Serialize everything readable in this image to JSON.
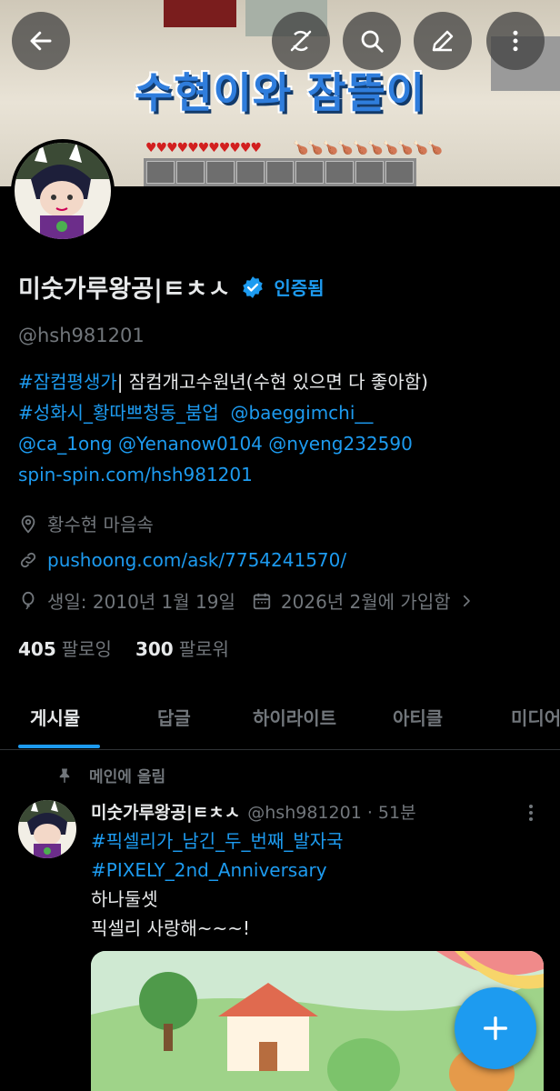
{
  "banner": {
    "title": "수현이와 잠뜰이",
    "hearts": "♥♥♥♥♥♥♥♥♥♥♥",
    "food": "🍗🍗🍗🍗🍗🍗🍗🍗🍗🍗"
  },
  "topbar": {
    "back": "back-arrow-icon",
    "actions": [
      "no-sync-icon",
      "search-icon",
      "edit-pen-icon",
      "more-vertical-icon"
    ]
  },
  "profile": {
    "name": "미숫가루왕공|ㅌㅊㅅ",
    "verified_label": "인증됨",
    "handle": "@hsh981201",
    "bio": {
      "line1_tag": "#잠컴평생가",
      "line1_text": "| 잠컴개고수원년(수현 있으면 다 좋아함)",
      "line2_tag": "#성화시_황따쁘청동_붐업",
      "line2_mention": "@baeggimchi__",
      "line3": "@ca_1ong @Yenanow0104 @nyeng232590",
      "line4": "spin-spin.com/hsh981201"
    },
    "location": "황수현 마음속",
    "website": "pushoong.com/ask/7754241570/",
    "birthday": "생일: 2010년 1월 19일",
    "joined": "2026년 2월에 가입함",
    "following_count": "405",
    "following_label": "팔로잉",
    "followers_count": "300",
    "followers_label": "팔로워"
  },
  "tabs": [
    "게시물",
    "답글",
    "하이라이트",
    "아티클",
    "미디어"
  ],
  "post": {
    "pinned_label": "메인에 올림",
    "author_name": "미숫가루왕공|ㅌㅊㅅ",
    "author_meta": "@hsh981201 · 51분",
    "tag1": "#픽셀리가_남긴_두_번째_발자국",
    "tag2": "#PIXELY_2nd_Anniversary",
    "text1": "하나둘셋",
    "text2": "픽셀리 사랑해~~~!"
  },
  "colors": {
    "accent": "#1d9bf0",
    "muted": "#71767b",
    "text": "#e7e9ea",
    "background": "#000000"
  }
}
